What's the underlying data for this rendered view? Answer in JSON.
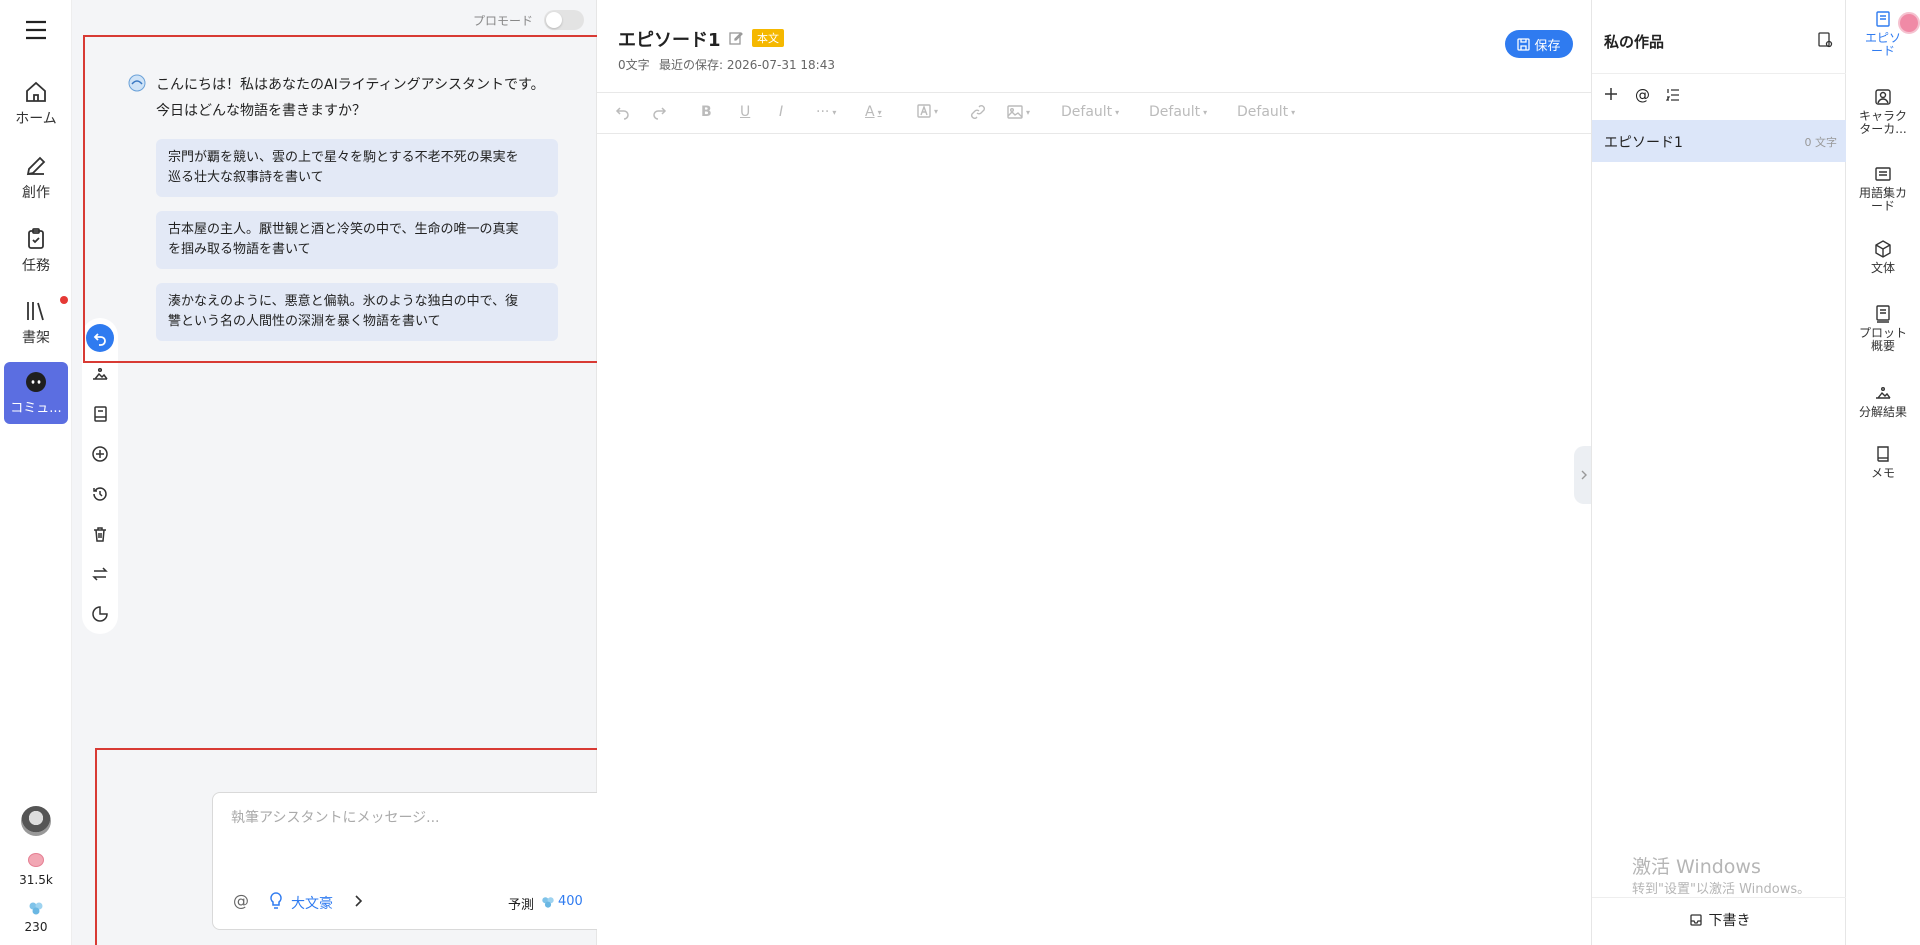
{
  "left_nav": {
    "items": [
      {
        "label": "ホーム",
        "icon": "home-icon"
      },
      {
        "label": "創作",
        "icon": "pen-icon"
      },
      {
        "label": "任務",
        "icon": "clipboard-icon"
      },
      {
        "label": "書架",
        "icon": "bookshelf-icon"
      },
      {
        "label": "コミュ...",
        "icon": "discord-icon"
      }
    ],
    "coins": "31.5k",
    "tokens": "230"
  },
  "chat": {
    "pro_mode_label": "プロモード",
    "greeting_line1": "こんにちは！私はあなたのAIライティングアシスタントです。",
    "greeting_line2": "今日はどんな物語を書きますか？",
    "suggestions": [
      {
        "line1": "宗門が覇を競い、雲の上で星々を駒とする不老不死の果実を",
        "line2": "巡る壮大な叙事詩を書いて"
      },
      {
        "line1": "古本屋の主人。厭世観と酒と冷笑の中で、生命の唯一の真実",
        "line2": "を掴み取る物語を書いて"
      },
      {
        "line1": "湊かなえのように、悪意と偏執。氷のような独白の中で、復",
        "line2": "讐という名の人間性の深淵を暴く物語を書いて"
      }
    ],
    "input_placeholder": "執筆アシスタントにメッセージ...",
    "model_label": "大文豪",
    "estimate_label": "予測",
    "estimate_value": "400"
  },
  "editor": {
    "title": "エピソード1",
    "tag": "本文",
    "word_count": "0文字",
    "last_saved": "最近の保存: 2026-07-31 18:43",
    "save_label": "保存",
    "font_select_1": "Default",
    "font_select_2": "Default",
    "font_select_3": "Default"
  },
  "works": {
    "title": "私の作品",
    "episodes": [
      {
        "name": "エピソード1",
        "count": "0 文字"
      }
    ],
    "draft_label": "下書き",
    "watermark_line1": "激活 Windows",
    "watermark_line2": "转到\"设置\"以激活 Windows。"
  },
  "right_rail": {
    "items": [
      {
        "label": "エピソード",
        "icon": "episode-icon"
      },
      {
        "label": "キャラクターカ...",
        "icon": "character-card-icon"
      },
      {
        "label": "用語集カード",
        "icon": "glossary-icon"
      },
      {
        "label": "文体",
        "icon": "cube-icon"
      },
      {
        "label": "プロット概要",
        "icon": "plot-icon"
      },
      {
        "label": "分解結果",
        "icon": "breakdown-icon"
      },
      {
        "label": "メモ",
        "icon": "memo-icon"
      }
    ]
  },
  "colors": {
    "accent": "#2f7bf0",
    "nav_active": "#5b6ee1",
    "tag": "#f5b800",
    "annotation": "#d83a34",
    "episode_selected": "#dce6f9"
  }
}
